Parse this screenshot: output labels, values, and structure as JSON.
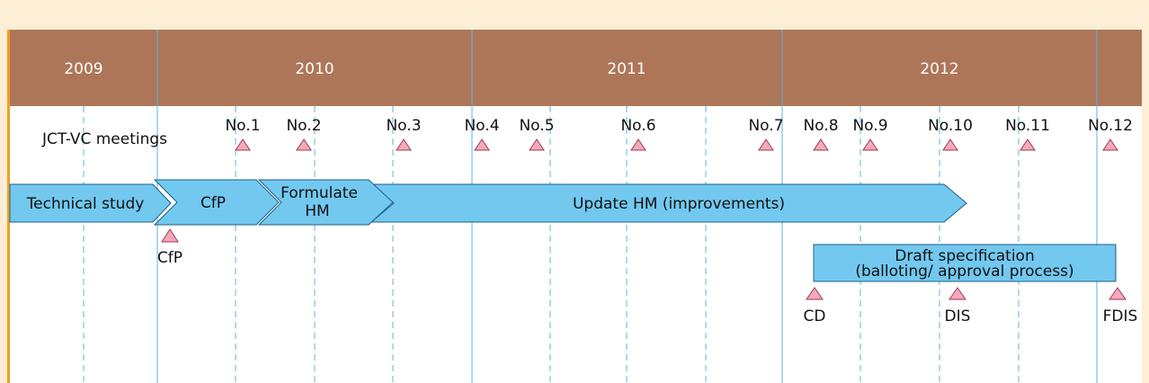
{
  "years": [
    "2009",
    "2010",
    "2011",
    "2012"
  ],
  "meetings_label": "JCT-VC meetings",
  "meetings": [
    "No.1",
    "No.2",
    "No.3",
    "No.4",
    "No.5",
    "No.6",
    "No.7",
    "No.8",
    "No.9",
    "No.10",
    "No.11",
    "No.12"
  ],
  "phases": [
    {
      "id": "technical-study",
      "lines": [
        "Technical study"
      ]
    },
    {
      "id": "cfp",
      "lines": [
        "CfP"
      ]
    },
    {
      "id": "formulate-hm",
      "lines": [
        "Formulate",
        "HM"
      ]
    },
    {
      "id": "update-hm",
      "lines": [
        "Update HM (improvements)"
      ]
    }
  ],
  "draft_box": {
    "lines": [
      "Draft specification",
      "(balloting/ approval process)"
    ]
  },
  "milestones": [
    "CfP",
    "CD",
    "DIS",
    "FDIS"
  ],
  "colors": {
    "background": "#fdeed6",
    "year_bar": "#ae7659",
    "year_text": "#ffffff",
    "panel": "#ffffff",
    "arrow_fill": "#73c8ef",
    "arrow_stroke": "#1c5f8a",
    "triangle_fill": "#f3a9b8",
    "triangle_stroke": "#9b3b55",
    "gridline": "#5bb4dc",
    "left_border": "#f0a020"
  }
}
